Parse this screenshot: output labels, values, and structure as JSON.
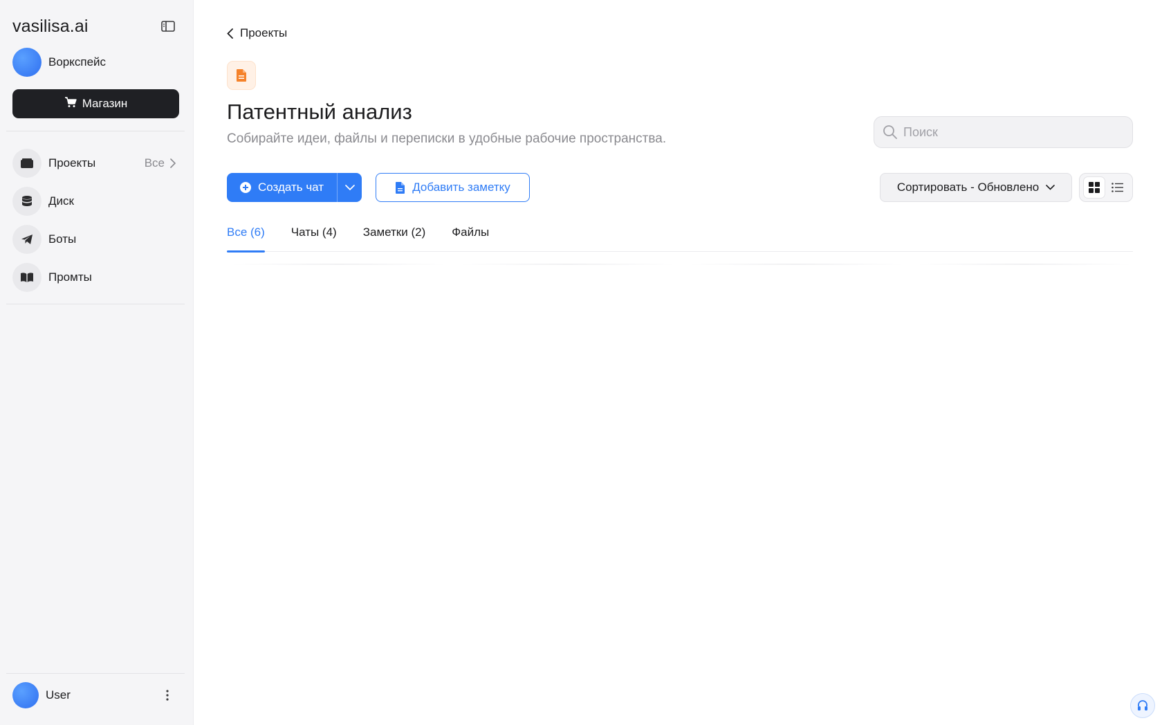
{
  "sidebar": {
    "brand": "vasilisa.ai",
    "workspace_label": "Воркспейс",
    "shop_label": "Магазин",
    "nav": [
      {
        "label": "Проекты",
        "icon": "folder-icon",
        "extra": "Все"
      },
      {
        "label": "Диск",
        "icon": "database-icon"
      },
      {
        "label": "Боты",
        "icon": "telegram-icon"
      },
      {
        "label": "Промты",
        "icon": "book-icon"
      }
    ],
    "user_label": "User"
  },
  "main": {
    "back_label": "Проекты",
    "title": "Патентный анализ",
    "subtitle": "Собирайте идеи, файлы и переписки в удобные рабочие пространства.",
    "search_placeholder": "Поиск",
    "create_chat_label": "Создать чат",
    "add_note_label": "Добавить заметку",
    "sort_label": "Сортировать - Обновлено",
    "tabs": [
      {
        "label": "Все (6)",
        "active": true
      },
      {
        "label": "Чаты (4)"
      },
      {
        "label": "Заметки (2)"
      },
      {
        "label": "Файлы"
      }
    ]
  },
  "colors": {
    "accent": "#2f7cf6",
    "dark_button": "#1f2024",
    "project_icon": "#f5822a"
  }
}
